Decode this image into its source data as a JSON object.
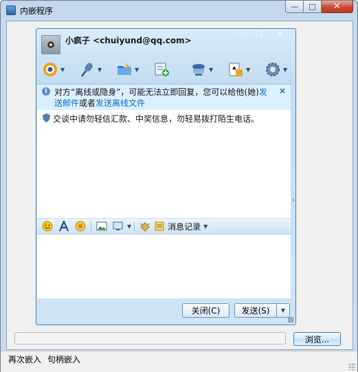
{
  "outer_window": {
    "title": "内嵌程序",
    "minimize_glyph": "—",
    "maximize_glyph": "□",
    "close_glyph": "✕"
  },
  "qq_window": {
    "contact": "小疯子 <chuiyund@qq.com>",
    "min_glyph": "—",
    "max_glyph": "□",
    "close_glyph": "✕",
    "toolbar_icons": [
      "video-call-icon",
      "voice-call-icon",
      "send-file-icon",
      "create-group-icon",
      "remote-assist-icon",
      "app-icon",
      "settings-icon"
    ],
    "notice": {
      "text_1": "对方“离线或隐身”，可能无法立即回复，您可以给他(她)",
      "link_1": "发送邮件",
      "text_2": "或者",
      "link_2": "发送离线文件",
      "close": "×"
    },
    "security_text": "交谈中请勿轻信汇款、中奖信息，勿轻易拨打陌生电话。",
    "format_bar": {
      "icons": [
        "emoticon-icon",
        "font-icon",
        "magic-emoticon-icon",
        "screenshot-icon",
        "image-icon",
        "shake-icon"
      ],
      "history_label": "消息记录"
    },
    "close_button": "关闭(C)",
    "send_button": "发送(S)"
  },
  "bottom": {
    "url_value": "",
    "browse_button": "浏览...",
    "status_1": "再次嵌入",
    "status_2": "句柄嵌入"
  },
  "colors": {
    "qq_border": "#4a7fb0",
    "link": "#0a6fc5",
    "notice_bg": "#dcefff"
  }
}
